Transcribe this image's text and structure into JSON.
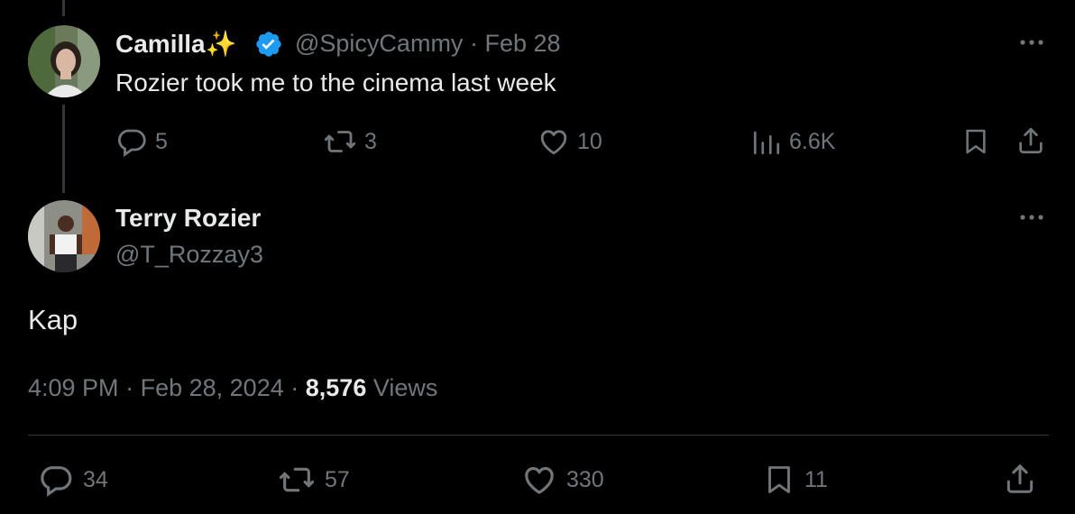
{
  "parent_tweet": {
    "display_name": "Camilla",
    "name_emoji": "✨",
    "handle": "@SpicyCammy",
    "separator": "·",
    "date": "Feb 28",
    "text": "Rozier took me to the cinema last week",
    "metrics": {
      "replies": "5",
      "reposts": "3",
      "likes": "10",
      "views": "6.6K"
    }
  },
  "main_tweet": {
    "display_name": "Terry Rozier",
    "handle": "@T_Rozzay3",
    "text": "Kap",
    "time": "4:09 PM",
    "date": "Feb 28, 2024",
    "views_count": "8,576",
    "views_label": "Views",
    "metrics": {
      "replies": "34",
      "reposts": "57",
      "likes": "330",
      "bookmarks": "11"
    }
  },
  "colors": {
    "background": "#000000",
    "text": "#e7e9ea",
    "muted": "#71767b",
    "verified": "#1d9bf0",
    "divider": "#2f3336"
  }
}
